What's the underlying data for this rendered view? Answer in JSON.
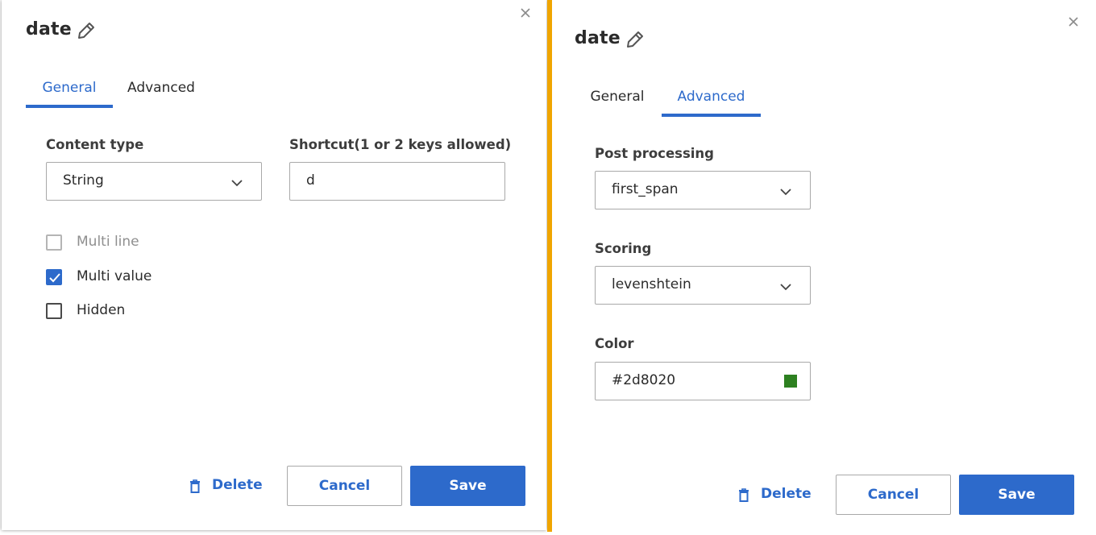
{
  "colors": {
    "accent": "#2d6acb",
    "divider": "#f0a500",
    "swatch": "#2d8020"
  },
  "left": {
    "title": "date",
    "tabs": [
      {
        "label": "General",
        "active": true
      },
      {
        "label": "Advanced",
        "active": false
      }
    ],
    "content_type": {
      "label": "Content type",
      "value": "String"
    },
    "shortcut": {
      "label": "Shortcut(1 or 2 keys allowed)",
      "value": "d"
    },
    "checkboxes": [
      {
        "label": "Multi line",
        "checked": false,
        "disabled": true
      },
      {
        "label": "Multi value",
        "checked": true,
        "disabled": false
      },
      {
        "label": "Hidden",
        "checked": false,
        "disabled": false
      }
    ],
    "buttons": {
      "delete": "Delete",
      "cancel": "Cancel",
      "save": "Save"
    }
  },
  "right": {
    "title": "date",
    "tabs": [
      {
        "label": "General",
        "active": false
      },
      {
        "label": "Advanced",
        "active": true
      }
    ],
    "post_processing": {
      "label": "Post processing",
      "value": "first_span"
    },
    "scoring": {
      "label": "Scoring",
      "value": "levenshtein"
    },
    "color": {
      "label": "Color",
      "value": "#2d8020"
    },
    "buttons": {
      "delete": "Delete",
      "cancel": "Cancel",
      "save": "Save"
    }
  }
}
